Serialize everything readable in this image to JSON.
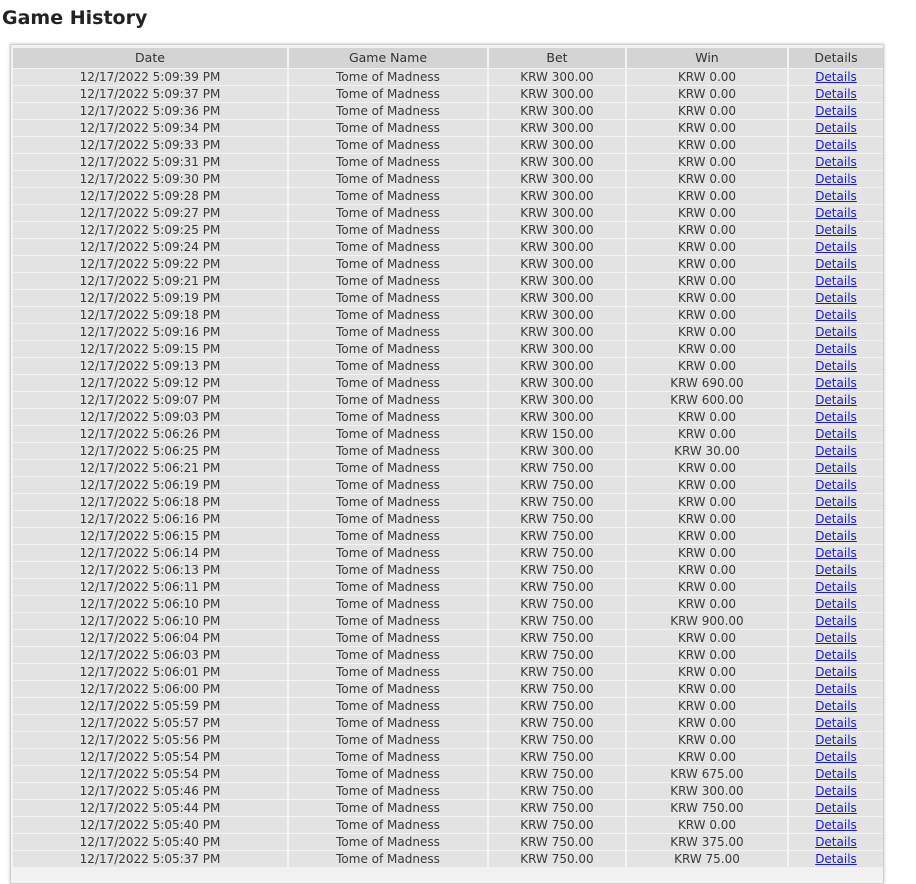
{
  "page": {
    "title": "Game History"
  },
  "table": {
    "columns": [
      "Date",
      "Game Name",
      "Bet",
      "Win",
      "Details"
    ],
    "rows": [
      {
        "date": "12/17/2022 5:09:39 PM",
        "game": "Tome of Madness",
        "bet": "KRW 300.00",
        "win": "KRW 0.00",
        "details": "Details"
      },
      {
        "date": "12/17/2022 5:09:37 PM",
        "game": "Tome of Madness",
        "bet": "KRW 300.00",
        "win": "KRW 0.00",
        "details": "Details"
      },
      {
        "date": "12/17/2022 5:09:36 PM",
        "game": "Tome of Madness",
        "bet": "KRW 300.00",
        "win": "KRW 0.00",
        "details": "Details"
      },
      {
        "date": "12/17/2022 5:09:34 PM",
        "game": "Tome of Madness",
        "bet": "KRW 300.00",
        "win": "KRW 0.00",
        "details": "Details"
      },
      {
        "date": "12/17/2022 5:09:33 PM",
        "game": "Tome of Madness",
        "bet": "KRW 300.00",
        "win": "KRW 0.00",
        "details": "Details"
      },
      {
        "date": "12/17/2022 5:09:31 PM",
        "game": "Tome of Madness",
        "bet": "KRW 300.00",
        "win": "KRW 0.00",
        "details": "Details"
      },
      {
        "date": "12/17/2022 5:09:30 PM",
        "game": "Tome of Madness",
        "bet": "KRW 300.00",
        "win": "KRW 0.00",
        "details": "Details"
      },
      {
        "date": "12/17/2022 5:09:28 PM",
        "game": "Tome of Madness",
        "bet": "KRW 300.00",
        "win": "KRW 0.00",
        "details": "Details"
      },
      {
        "date": "12/17/2022 5:09:27 PM",
        "game": "Tome of Madness",
        "bet": "KRW 300.00",
        "win": "KRW 0.00",
        "details": "Details"
      },
      {
        "date": "12/17/2022 5:09:25 PM",
        "game": "Tome of Madness",
        "bet": "KRW 300.00",
        "win": "KRW 0.00",
        "details": "Details"
      },
      {
        "date": "12/17/2022 5:09:24 PM",
        "game": "Tome of Madness",
        "bet": "KRW 300.00",
        "win": "KRW 0.00",
        "details": "Details"
      },
      {
        "date": "12/17/2022 5:09:22 PM",
        "game": "Tome of Madness",
        "bet": "KRW 300.00",
        "win": "KRW 0.00",
        "details": "Details"
      },
      {
        "date": "12/17/2022 5:09:21 PM",
        "game": "Tome of Madness",
        "bet": "KRW 300.00",
        "win": "KRW 0.00",
        "details": "Details"
      },
      {
        "date": "12/17/2022 5:09:19 PM",
        "game": "Tome of Madness",
        "bet": "KRW 300.00",
        "win": "KRW 0.00",
        "details": "Details"
      },
      {
        "date": "12/17/2022 5:09:18 PM",
        "game": "Tome of Madness",
        "bet": "KRW 300.00",
        "win": "KRW 0.00",
        "details": "Details"
      },
      {
        "date": "12/17/2022 5:09:16 PM",
        "game": "Tome of Madness",
        "bet": "KRW 300.00",
        "win": "KRW 0.00",
        "details": "Details"
      },
      {
        "date": "12/17/2022 5:09:15 PM",
        "game": "Tome of Madness",
        "bet": "KRW 300.00",
        "win": "KRW 0.00",
        "details": "Details"
      },
      {
        "date": "12/17/2022 5:09:13 PM",
        "game": "Tome of Madness",
        "bet": "KRW 300.00",
        "win": "KRW 0.00",
        "details": "Details"
      },
      {
        "date": "12/17/2022 5:09:12 PM",
        "game": "Tome of Madness",
        "bet": "KRW 300.00",
        "win": "KRW 690.00",
        "details": "Details"
      },
      {
        "date": "12/17/2022 5:09:07 PM",
        "game": "Tome of Madness",
        "bet": "KRW 300.00",
        "win": "KRW 600.00",
        "details": "Details"
      },
      {
        "date": "12/17/2022 5:09:03 PM",
        "game": "Tome of Madness",
        "bet": "KRW 300.00",
        "win": "KRW 0.00",
        "details": "Details"
      },
      {
        "date": "12/17/2022 5:06:26 PM",
        "game": "Tome of Madness",
        "bet": "KRW 150.00",
        "win": "KRW 0.00",
        "details": "Details"
      },
      {
        "date": "12/17/2022 5:06:25 PM",
        "game": "Tome of Madness",
        "bet": "KRW 300.00",
        "win": "KRW 30.00",
        "details": "Details"
      },
      {
        "date": "12/17/2022 5:06:21 PM",
        "game": "Tome of Madness",
        "bet": "KRW 750.00",
        "win": "KRW 0.00",
        "details": "Details"
      },
      {
        "date": "12/17/2022 5:06:19 PM",
        "game": "Tome of Madness",
        "bet": "KRW 750.00",
        "win": "KRW 0.00",
        "details": "Details"
      },
      {
        "date": "12/17/2022 5:06:18 PM",
        "game": "Tome of Madness",
        "bet": "KRW 750.00",
        "win": "KRW 0.00",
        "details": "Details"
      },
      {
        "date": "12/17/2022 5:06:16 PM",
        "game": "Tome of Madness",
        "bet": "KRW 750.00",
        "win": "KRW 0.00",
        "details": "Details"
      },
      {
        "date": "12/17/2022 5:06:15 PM",
        "game": "Tome of Madness",
        "bet": "KRW 750.00",
        "win": "KRW 0.00",
        "details": "Details"
      },
      {
        "date": "12/17/2022 5:06:14 PM",
        "game": "Tome of Madness",
        "bet": "KRW 750.00",
        "win": "KRW 0.00",
        "details": "Details"
      },
      {
        "date": "12/17/2022 5:06:13 PM",
        "game": "Tome of Madness",
        "bet": "KRW 750.00",
        "win": "KRW 0.00",
        "details": "Details"
      },
      {
        "date": "12/17/2022 5:06:11 PM",
        "game": "Tome of Madness",
        "bet": "KRW 750.00",
        "win": "KRW 0.00",
        "details": "Details"
      },
      {
        "date": "12/17/2022 5:06:10 PM",
        "game": "Tome of Madness",
        "bet": "KRW 750.00",
        "win": "KRW 0.00",
        "details": "Details"
      },
      {
        "date": "12/17/2022 5:06:10 PM",
        "game": "Tome of Madness",
        "bet": "KRW 750.00",
        "win": "KRW 900.00",
        "details": "Details"
      },
      {
        "date": "12/17/2022 5:06:04 PM",
        "game": "Tome of Madness",
        "bet": "KRW 750.00",
        "win": "KRW 0.00",
        "details": "Details"
      },
      {
        "date": "12/17/2022 5:06:03 PM",
        "game": "Tome of Madness",
        "bet": "KRW 750.00",
        "win": "KRW 0.00",
        "details": "Details"
      },
      {
        "date": "12/17/2022 5:06:01 PM",
        "game": "Tome of Madness",
        "bet": "KRW 750.00",
        "win": "KRW 0.00",
        "details": "Details"
      },
      {
        "date": "12/17/2022 5:06:00 PM",
        "game": "Tome of Madness",
        "bet": "KRW 750.00",
        "win": "KRW 0.00",
        "details": "Details"
      },
      {
        "date": "12/17/2022 5:05:59 PM",
        "game": "Tome of Madness",
        "bet": "KRW 750.00",
        "win": "KRW 0.00",
        "details": "Details"
      },
      {
        "date": "12/17/2022 5:05:57 PM",
        "game": "Tome of Madness",
        "bet": "KRW 750.00",
        "win": "KRW 0.00",
        "details": "Details"
      },
      {
        "date": "12/17/2022 5:05:56 PM",
        "game": "Tome of Madness",
        "bet": "KRW 750.00",
        "win": "KRW 0.00",
        "details": "Details"
      },
      {
        "date": "12/17/2022 5:05:54 PM",
        "game": "Tome of Madness",
        "bet": "KRW 750.00",
        "win": "KRW 0.00",
        "details": "Details"
      },
      {
        "date": "12/17/2022 5:05:54 PM",
        "game": "Tome of Madness",
        "bet": "KRW 750.00",
        "win": "KRW 675.00",
        "details": "Details"
      },
      {
        "date": "12/17/2022 5:05:46 PM",
        "game": "Tome of Madness",
        "bet": "KRW 750.00",
        "win": "KRW 300.00",
        "details": "Details"
      },
      {
        "date": "12/17/2022 5:05:44 PM",
        "game": "Tome of Madness",
        "bet": "KRW 750.00",
        "win": "KRW 750.00",
        "details": "Details"
      },
      {
        "date": "12/17/2022 5:05:40 PM",
        "game": "Tome of Madness",
        "bet": "KRW 750.00",
        "win": "KRW 0.00",
        "details": "Details"
      },
      {
        "date": "12/17/2022 5:05:40 PM",
        "game": "Tome of Madness",
        "bet": "KRW 750.00",
        "win": "KRW 375.00",
        "details": "Details"
      },
      {
        "date": "12/17/2022 5:05:37 PM",
        "game": "Tome of Madness",
        "bet": "KRW 750.00",
        "win": "KRW 75.00",
        "details": "Details"
      }
    ]
  }
}
